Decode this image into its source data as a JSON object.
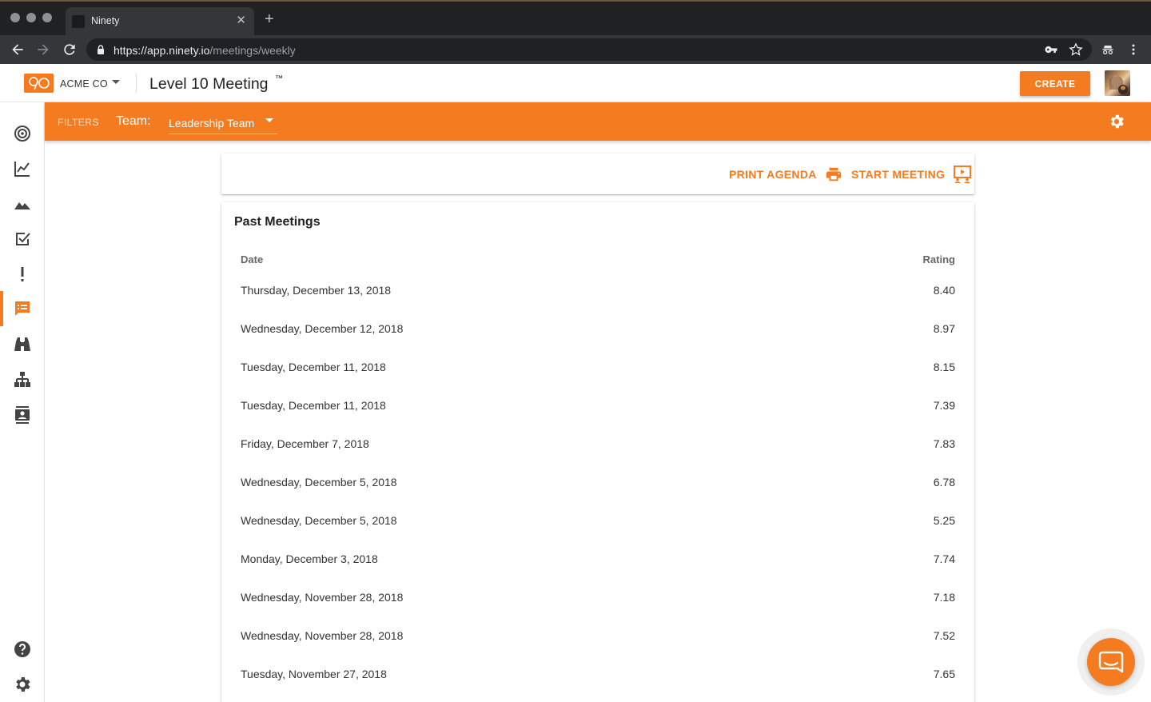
{
  "browser": {
    "tab_title": "Ninety",
    "url_scheme": "https://",
    "url_host": "app.ninety.io",
    "url_path": "/meetings/weekly"
  },
  "header": {
    "org_name": "ACME CO",
    "page_title": "Level 10 Meeting",
    "trademark": "™",
    "create_label": "CREATE"
  },
  "filters": {
    "label": "FILTERS",
    "team_label": "Team:",
    "team_value": "Leadership Team"
  },
  "actions": {
    "print_agenda": "PRINT AGENDA",
    "start_meeting": "START MEETING"
  },
  "past_meetings": {
    "title": "Past Meetings",
    "columns": {
      "date": "Date",
      "rating": "Rating"
    },
    "rows": [
      {
        "date": "Thursday, December 13, 2018",
        "rating": "8.40"
      },
      {
        "date": "Wednesday, December 12, 2018",
        "rating": "8.97"
      },
      {
        "date": "Tuesday, December 11, 2018",
        "rating": "8.15"
      },
      {
        "date": "Tuesday, December 11, 2018",
        "rating": "7.39"
      },
      {
        "date": "Friday, December 7, 2018",
        "rating": "7.83"
      },
      {
        "date": "Wednesday, December 5, 2018",
        "rating": "6.78"
      },
      {
        "date": "Wednesday, December 5, 2018",
        "rating": "5.25"
      },
      {
        "date": "Monday, December 3, 2018",
        "rating": "7.74"
      },
      {
        "date": "Wednesday, November 28, 2018",
        "rating": "7.18"
      },
      {
        "date": "Wednesday, November 28, 2018",
        "rating": "7.52"
      },
      {
        "date": "Tuesday, November 27, 2018",
        "rating": "7.65"
      }
    ]
  },
  "sidebar": {
    "items": [
      {
        "icon": "target-icon"
      },
      {
        "icon": "line-chart-icon"
      },
      {
        "icon": "mountain-icon"
      },
      {
        "icon": "checkbox-icon"
      },
      {
        "icon": "exclamation-icon"
      },
      {
        "icon": "chat-list-icon"
      },
      {
        "icon": "binoculars-icon"
      },
      {
        "icon": "org-chart-icon"
      },
      {
        "icon": "contact-card-icon"
      }
    ],
    "bottom": [
      {
        "icon": "help-icon"
      },
      {
        "icon": "settings-icon"
      }
    ]
  },
  "colors": {
    "accent": "#f47b20",
    "chrome_dark": "#202124",
    "chrome_toolbar": "#35363a",
    "text": "#333333"
  }
}
